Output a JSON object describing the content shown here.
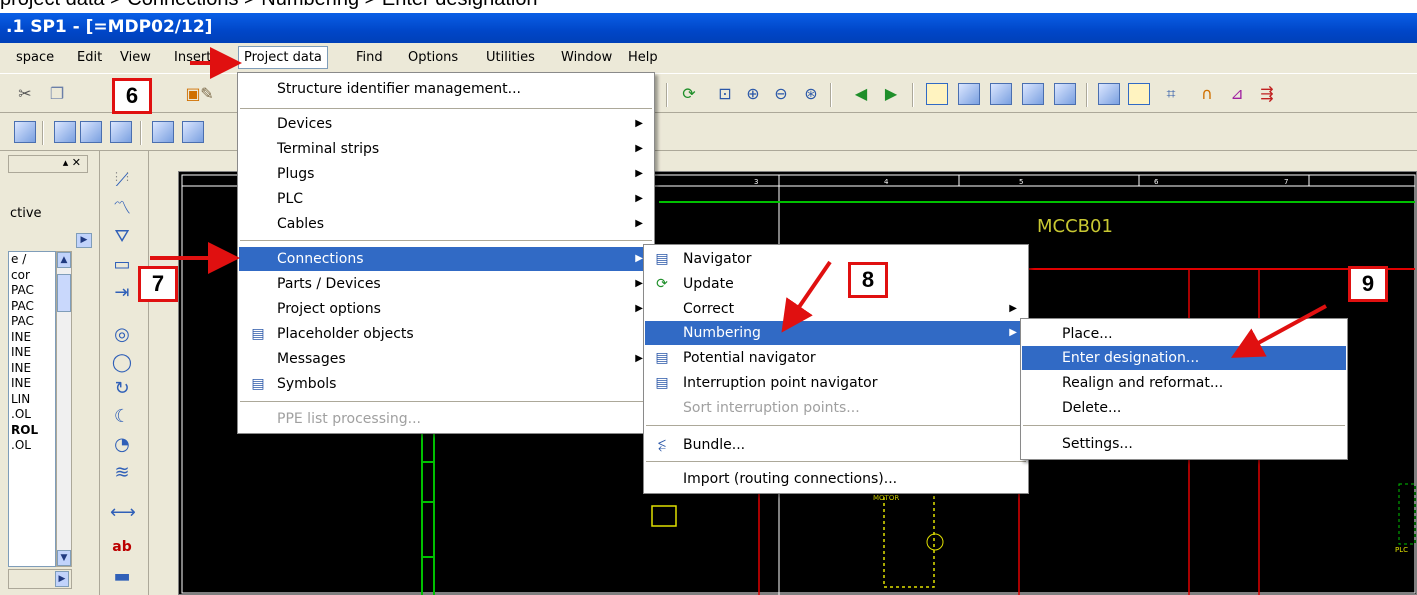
{
  "caption": "project data > Connections > Numbering > Enter designation",
  "window": {
    "title": ".1 SP1 - [=MDP02/12]"
  },
  "menubar": {
    "items": [
      "space",
      "Edit",
      "View",
      "Insert",
      "Project data",
      "Find",
      "Options",
      "Utilities",
      "Window",
      "Help"
    ]
  },
  "left_panel": {
    "label": "ctive",
    "list_header": "e /",
    "list": [
      "cor",
      "PAC",
      "PAC",
      "PAC",
      "INE",
      "INE",
      "INE",
      "INE",
      "LIN",
      ".OL",
      "ROL",
      ".OL"
    ]
  },
  "canvas": {
    "title": "MCCB01",
    "column_numbers": [
      "3",
      "4",
      "5",
      "6",
      "7"
    ],
    "motor_label": "MOTOR",
    "plc_label": "PLC"
  },
  "project_data_menu": {
    "items": [
      {
        "label": "Structure identifier management...",
        "submenu": false
      },
      {
        "label": "Devices",
        "submenu": true
      },
      {
        "label": "Terminal strips",
        "submenu": true
      },
      {
        "label": "Plugs",
        "submenu": true
      },
      {
        "label": "PLC",
        "submenu": true
      },
      {
        "label": "Cables",
        "submenu": true
      },
      {
        "label": "Connections",
        "submenu": true,
        "highlighted": true
      },
      {
        "label": "Parts / Devices",
        "submenu": true
      },
      {
        "label": "Project options",
        "submenu": true
      },
      {
        "label": "Placeholder objects",
        "submenu": false
      },
      {
        "label": "Messages",
        "submenu": true
      },
      {
        "label": "Symbols",
        "submenu": false
      },
      {
        "label": "PPE list processing...",
        "submenu": false,
        "disabled": true
      }
    ]
  },
  "connections_menu": {
    "items": [
      {
        "label": "Navigator"
      },
      {
        "label": "Update"
      },
      {
        "label": "Correct"
      },
      {
        "label": "Numbering",
        "highlighted": true,
        "submenu": true
      },
      {
        "label": "Potential navigator"
      },
      {
        "label": "Interruption point navigator"
      },
      {
        "label": "Sort interruption points...",
        "disabled": true
      },
      {
        "label": "Bundle..."
      },
      {
        "label": "Import (routing connections)..."
      }
    ]
  },
  "numbering_menu": {
    "items": [
      {
        "label": "Place..."
      },
      {
        "label": "Enter designation...",
        "highlighted": true
      },
      {
        "label": "Realign and reformat..."
      },
      {
        "label": "Delete..."
      },
      {
        "label": "Settings..."
      }
    ]
  },
  "steps": [
    "6",
    "7",
    "8",
    "9"
  ],
  "colors": {
    "highlight": "#316ac5",
    "annotation": "#e01010",
    "titlebar": "#0046c8"
  }
}
